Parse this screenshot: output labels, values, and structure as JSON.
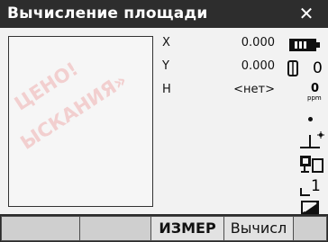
{
  "window": {
    "title": "Вычисление площади",
    "close_glyph": "✕"
  },
  "readouts": [
    {
      "label": "X",
      "value": "0.000"
    },
    {
      "label": "Y",
      "value": "0.000"
    },
    {
      "label": "H",
      "value": "<нет>"
    }
  ],
  "status": {
    "battery_icon": "battery-icon",
    "prism_icon": "prism-icon",
    "prism_constant": "0",
    "ppm_value": "0",
    "ppm_unit": "ppm",
    "signal_icon": "signal-dot-icon",
    "tilt_icon": "tilt-compensation-icon",
    "target_mode_icon": "target-mode-icon",
    "page_number": "1",
    "input_mode_icon": "input-mode-icon"
  },
  "softkeys": [
    "",
    "",
    "ИЗМЕР",
    "Вычисл",
    ""
  ],
  "watermark": [
    "ЦЕНО!",
    "ЫСКАНИЯ»"
  ]
}
